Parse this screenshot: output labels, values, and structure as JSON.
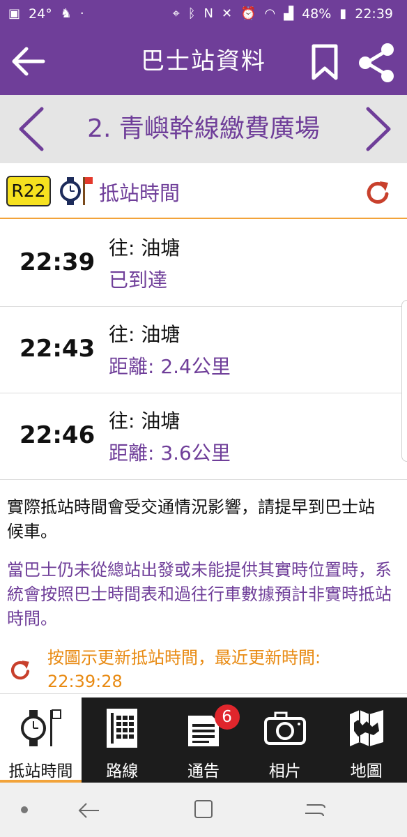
{
  "status_bar": {
    "temperature": "24°",
    "battery_percent": "48%",
    "clock": "22:39",
    "left_icons": [
      "photo-icon",
      "weather-icon",
      "bird-icon",
      "dot-icon"
    ],
    "right_icons": [
      "location-icon",
      "bluetooth-icon",
      "nfc-icon",
      "mute-icon",
      "alarm-icon",
      "volte-wifi-icon",
      "wifi-icon",
      "sim1-icon",
      "signal-icon",
      "signal2-icon",
      "battery-icon"
    ]
  },
  "header": {
    "title": "巴士站資料"
  },
  "stop_nav": {
    "stop_name": "2. 青嶼幹線繳費廣場"
  },
  "eta_section": {
    "route": "R22",
    "label": "抵站時間"
  },
  "etas": [
    {
      "time": "22:39",
      "destination": "往: 油塘",
      "status": "已到達"
    },
    {
      "time": "22:43",
      "destination": "往: 油塘",
      "status": "距離: 2.4公里"
    },
    {
      "time": "22:46",
      "destination": "往: 油塘",
      "status": "距離: 3.6公里"
    }
  ],
  "notices": {
    "traffic": "實際抵站時間會受交通情況影響，請提早到巴士站候車。",
    "schedule": "當巴士仍未從總站出發或未能提供其實時位置時，系統會按照巴士時間表和過往行車數據預計非實時抵站時間。",
    "update_hint": "按圖示更新抵站時間，最近更新時間: 22:39:28"
  },
  "bottom_nav": {
    "tabs": [
      {
        "label": "抵站時間",
        "icon": "clock-flag-icon",
        "active": true
      },
      {
        "label": "路線",
        "icon": "route-table-icon",
        "active": false
      },
      {
        "label": "通告",
        "icon": "notice-icon",
        "active": false,
        "badge": "6"
      },
      {
        "label": "相片",
        "icon": "camera-icon",
        "active": false
      },
      {
        "label": "地圖",
        "icon": "map-icon",
        "active": false
      }
    ]
  },
  "colors": {
    "primary": "#6f3e99",
    "accent": "#f2a33a",
    "refresh": "#c8402c",
    "badge": "#e0262c",
    "route_badge": "#f6e11f"
  }
}
